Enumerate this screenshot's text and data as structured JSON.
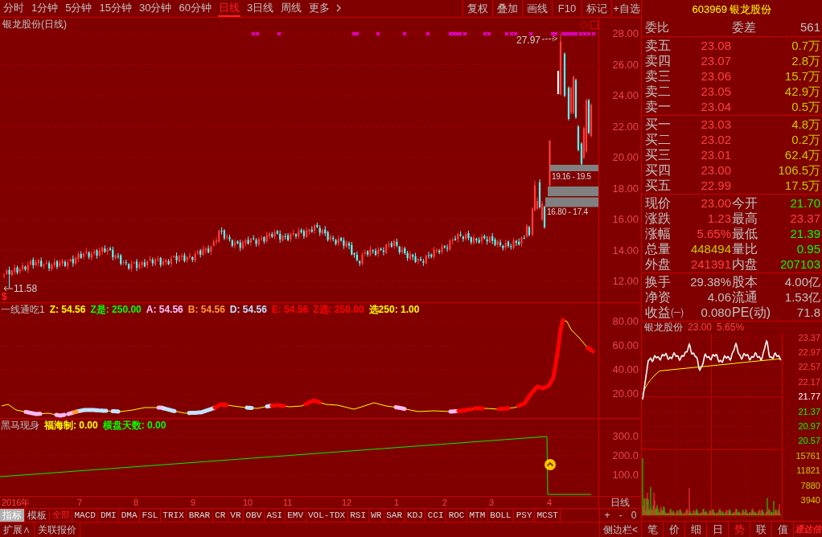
{
  "toolbar": {
    "periods": [
      {
        "label": "分时",
        "kind": "period",
        "selected": false
      },
      {
        "label": "1分钟",
        "kind": "period",
        "selected": false
      },
      {
        "label": "5分钟",
        "kind": "period",
        "selected": false
      },
      {
        "label": "15分钟",
        "kind": "period",
        "selected": false
      },
      {
        "label": "30分钟",
        "kind": "period",
        "selected": false
      },
      {
        "label": "60分钟",
        "kind": "period",
        "selected": false
      },
      {
        "label": "日线",
        "kind": "period",
        "selected": true
      },
      {
        "label": "3日线",
        "kind": "period",
        "selected": false
      },
      {
        "label": "周线",
        "kind": "period",
        "selected": false
      },
      {
        "label": "更多",
        "kind": "menu",
        "selected": false
      }
    ],
    "buttons": [
      "复权",
      "叠加",
      "画线",
      "F10",
      "标记",
      "+自选"
    ]
  },
  "price_chart": {
    "title": "银龙股份(日线)",
    "high_label": "27.97",
    "low_label": "11.58",
    "range_labels": [
      "19.16 - 19.5",
      "16.80 - 17.4"
    ],
    "sign": "$",
    "y_axis": [
      "28.00",
      "26.00",
      "24.00",
      "22.00",
      "20.00",
      "18.00",
      "16.00",
      "14.00",
      "12.00"
    ]
  },
  "indicator_1": {
    "name": "一线通吃1",
    "values": [
      {
        "label": "Z: 54.56",
        "color": "#ffff00"
      },
      {
        "label": "Z是: 250.00",
        "color": "#00ff00"
      },
      {
        "label": "A: 54.56",
        "color": "#ffc0ff"
      },
      {
        "label": "B: 54.56",
        "color": "#ff9933"
      },
      {
        "label": "D: 54.56",
        "color": "#c0e0ff"
      },
      {
        "label": "E: 54.56",
        "color": "#ff0000"
      },
      {
        "label": "Z选: 250.00",
        "color": "#ff0000"
      },
      {
        "label": "选250: 1.00",
        "color": "#ffff00"
      }
    ],
    "y_axis": [
      "80.00",
      "60.00",
      "40.00",
      "20.00"
    ]
  },
  "indicator_2": {
    "name": "黑马现身",
    "values": [
      {
        "label": "福海制: 0.00",
        "color": "#ffff00"
      },
      {
        "label": "横盘天数: 0.00",
        "color": "#00ff00"
      }
    ],
    "y_axis": [
      "300.0",
      "200.0",
      "100.0"
    ]
  },
  "x_axis": {
    "labels": [
      "2016年",
      "7",
      "8",
      "9",
      "10",
      "11",
      "12",
      "1",
      "2",
      "3",
      "4"
    ],
    "period": "日线",
    "zoom_buttons": [
      "+",
      "-",
      "0"
    ]
  },
  "indicator_tabs": {
    "views": [
      {
        "label": "指标",
        "selected": true
      },
      {
        "label": "模板",
        "selected": false
      }
    ],
    "items": [
      {
        "label": "全部",
        "selected": true
      },
      {
        "label": "MACD",
        "selected": false
      },
      {
        "label": "DMI",
        "selected": false
      },
      {
        "label": "DMA",
        "selected": false
      },
      {
        "label": "FSL",
        "selected": false
      },
      {
        "label": "TRIX",
        "selected": false
      },
      {
        "label": "BRAR",
        "selected": false
      },
      {
        "label": "CR",
        "selected": false
      },
      {
        "label": "VR",
        "selected": false
      },
      {
        "label": "OBV",
        "selected": false
      },
      {
        "label": "ASI",
        "selected": false
      },
      {
        "label": "EMV",
        "selected": false
      },
      {
        "label": "VOL-TDX",
        "selected": false
      },
      {
        "label": "RSI",
        "selected": false
      },
      {
        "label": "WR",
        "selected": false
      },
      {
        "label": "SAR",
        "selected": false
      },
      {
        "label": "KDJ",
        "selected": false
      },
      {
        "label": "CCI",
        "selected": false
      },
      {
        "label": "ROC",
        "selected": false
      },
      {
        "label": "MTM",
        "selected": false
      },
      {
        "label": "BOLL",
        "selected": false
      },
      {
        "label": "PSY",
        "selected": false
      },
      {
        "label": "MCST",
        "selected": false
      }
    ]
  },
  "bottom_bar": {
    "buttons": [
      "扩展∧",
      "关联报价"
    ],
    "sidebar": "侧边栏<"
  },
  "quote_panel": {
    "title": "603969 银龙股份",
    "ratio_labels": [
      "委比",
      "委差"
    ],
    "ratio_difference": "561",
    "asks": [
      {
        "label": "卖五",
        "price": "23.08",
        "volume": "0.7万"
      },
      {
        "label": "卖四",
        "price": "23.07",
        "volume": "2.8万"
      },
      {
        "label": "卖三",
        "price": "23.06",
        "volume": "15.7万"
      },
      {
        "label": "卖二",
        "price": "23.05",
        "volume": "42.9万"
      },
      {
        "label": "卖一",
        "price": "23.04",
        "volume": "0.5万"
      }
    ],
    "bids": [
      {
        "label": "买一",
        "price": "23.03",
        "volume": "4.8万"
      },
      {
        "label": "买二",
        "price": "23.02",
        "volume": "0.2万"
      },
      {
        "label": "买三",
        "price": "23.01",
        "volume": "62.4万"
      },
      {
        "label": "买四",
        "price": "23.00",
        "volume": "106.5万"
      },
      {
        "label": "买五",
        "price": "22.99",
        "volume": "17.5万"
      }
    ],
    "stats": [
      {
        "label": "现价",
        "value": "23.00",
        "color": "#ff4040"
      },
      {
        "label": "今开",
        "value": "21.70",
        "color": "#00ff00"
      },
      {
        "label": "涨跌",
        "value": "1.23",
        "color": "#ff4040"
      },
      {
        "label": "最高",
        "value": "23.37",
        "color": "#ff4040"
      },
      {
        "label": "涨幅",
        "value": "5.65%",
        "color": "#ff4040"
      },
      {
        "label": "最低",
        "value": "21.39",
        "color": "#00ff00"
      },
      {
        "label": "总量",
        "value": "448494",
        "color": "#c8c800"
      },
      {
        "label": "量比",
        "value": "0.95",
        "color": "#00ff00"
      },
      {
        "label": "外盘",
        "value": "241391",
        "color": "#ff4040"
      },
      {
        "label": "内盘",
        "value": "207103",
        "color": "#00ff00"
      }
    ],
    "fundamentals": [
      {
        "label": "换手",
        "value": "29.38%"
      },
      {
        "label": "股本",
        "value": "4.00亿"
      },
      {
        "label": "净资",
        "value": "4.06"
      },
      {
        "label": "流通",
        "value": "1.53亿"
      },
      {
        "label": "收益㈠",
        "value": "0.080"
      },
      {
        "label": "PE(动)",
        "value": "71.8"
      }
    ]
  },
  "intraday_chart": {
    "name": "银龙股份",
    "price": "23.00",
    "change": "5.65%",
    "price_axis": [
      {
        "label": "23.37",
        "color": "#ff4040"
      },
      {
        "label": "22.97",
        "color": "#ff4040"
      },
      {
        "label": "22.57",
        "color": "#ff4040"
      },
      {
        "label": "22.17",
        "color": "#ff4040"
      },
      {
        "label": "21.77",
        "color": "#ffffff"
      },
      {
        "label": "21.37",
        "color": "#00ff00"
      },
      {
        "label": "20.97",
        "color": "#00ff00"
      },
      {
        "label": "20.57",
        "color": "#00ff00"
      }
    ],
    "volume_axis": [
      "15761",
      "11821",
      "7880",
      "3940"
    ]
  },
  "side_tabs": {
    "tabs": [
      {
        "label": "笔",
        "selected": false
      },
      {
        "label": "价",
        "selected": false
      },
      {
        "label": "细",
        "selected": false
      },
      {
        "label": "日",
        "selected": false
      },
      {
        "label": "势",
        "selected": true
      },
      {
        "label": "联",
        "selected": false
      },
      {
        "label": "值",
        "selected": false
      }
    ],
    "brand": "通达信"
  }
}
